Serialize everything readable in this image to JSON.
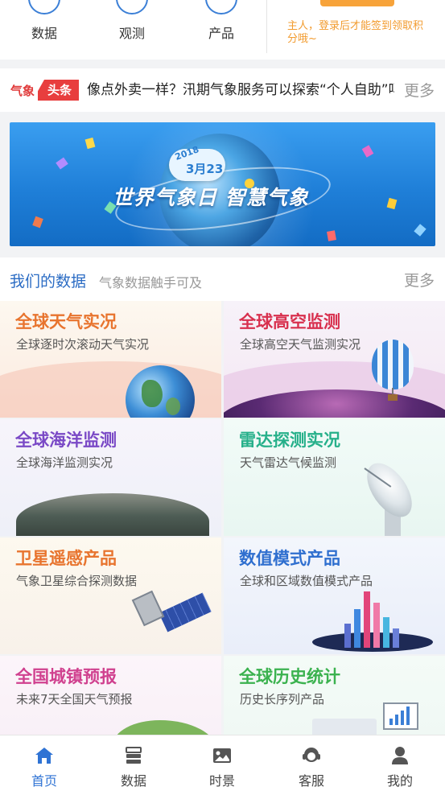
{
  "quick_nav": [
    {
      "label": "数据",
      "icon": "data-icon"
    },
    {
      "label": "观测",
      "icon": "observe-icon"
    },
    {
      "label": "产品",
      "icon": "product-icon"
    }
  ],
  "sign_in": {
    "tip": "主人，登录后才能签到领取积分哦~"
  },
  "headline": {
    "tag_left": "气象",
    "tag_right": "头条",
    "text": "像点外卖一样？汛期气象服务可以探索“个人自助”吗",
    "more": "更多"
  },
  "banner": {
    "year": "2018",
    "date": "3月23",
    "slogan": "世界气象日 智慧气象"
  },
  "section": {
    "title": "我们的数据",
    "subtitle": "气象数据触手可及",
    "more": "更多"
  },
  "tiles": [
    {
      "title": "全球天气实况",
      "desc": "全球逐时次滚动天气实况"
    },
    {
      "title": "全球高空监测",
      "desc": "全球高空天气监测实况"
    },
    {
      "title": "全球海洋监测",
      "desc": "全球海洋监测实况"
    },
    {
      "title": "雷达探测实况",
      "desc": "天气雷达气候监测"
    },
    {
      "title": "卫星遥感产品",
      "desc": "气象卫星综合探测数据"
    },
    {
      "title": "数值模式产品",
      "desc": "全球和区域数值模式产品"
    },
    {
      "title": "全国城镇预报",
      "desc": "未来7天全国天气预报"
    },
    {
      "title": "全球历史统计",
      "desc": "历史长序列产品"
    }
  ],
  "tabbar": [
    {
      "label": "首页",
      "icon": "home-icon"
    },
    {
      "label": "数据",
      "icon": "data-stack-icon"
    },
    {
      "label": "时景",
      "icon": "image-icon"
    },
    {
      "label": "客服",
      "icon": "service-icon"
    },
    {
      "label": "我的",
      "icon": "user-icon"
    }
  ],
  "colors": {
    "accent": "#2f73d4",
    "headline_red": "#e83e3e",
    "sign_orange": "#f29b2e"
  }
}
